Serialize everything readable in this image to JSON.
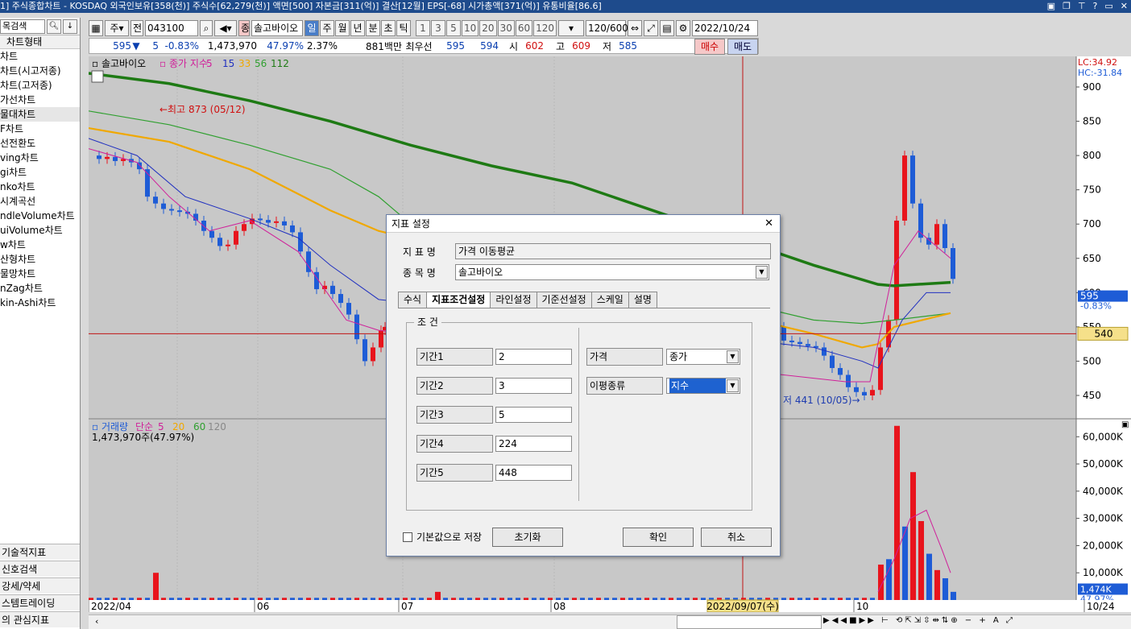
{
  "window": {
    "title": "1] 주식종합차트 - KOSDAQ 외국인보유[358(천)] 주식수[62,279(천)] 액면[500] 자본금[311(억)] 결산[12월] EPS[-68] 시가총액[371(억)] 유통비율[86.6]"
  },
  "left_panel": {
    "search_label": "목검색",
    "group_title": "차트형태",
    "items": [
      "차트",
      "차트(시고저종)",
      "차트(고저종)",
      "가선차트",
      "물대차트",
      "F차트",
      "선전환도",
      "ving차트",
      "gi차트",
      "nko차트",
      "시계곡선",
      "ndleVolume차트",
      "uiVolume차트",
      "w차트",
      "산형차트",
      "물망차트",
      "nZag차트",
      "kin-Ashi차트"
    ],
    "bottom": [
      "기술적지표",
      "신호검색",
      "강세/약세",
      "스템트레이딩",
      "의 관심지표"
    ]
  },
  "toolbar": {
    "code": "043100",
    "name": "솔고바이오",
    "periods": [
      "일",
      "주",
      "월",
      "년",
      "분",
      "초",
      "틱"
    ],
    "intervals": [
      "1",
      "3",
      "5",
      "10",
      "20",
      "30",
      "60",
      "120"
    ],
    "count": "120/600",
    "date": "2022/10/24",
    "jeon": "전",
    "ju": "주",
    "jong": "종"
  },
  "quote": {
    "price": "595",
    "change_arrow": "▼",
    "change": "5",
    "change_pct": "-0.83%",
    "volume": "1,473,970",
    "vol_ratio": "47.97%",
    "turnover": "2.37%",
    "amount": "881백만",
    "best_label": "최우선",
    "ask": "595",
    "bid": "594",
    "open_label": "시",
    "open": "602",
    "high_label": "고",
    "high": "609",
    "low_label": "저",
    "low": "585",
    "buy": "매수",
    "sell": "매도"
  },
  "chart": {
    "price_legend": {
      "name": "솔고바이오",
      "ma_title": "종가 지수",
      "periods": [
        "5",
        "15",
        "33",
        "56",
        "112"
      ]
    },
    "high_note": "최고 873 (05/12)",
    "low_note": "저 441 (10/05)",
    "lc": "LC:34.92",
    "hc": "HC:-31.84",
    "price_ticks": [
      "900",
      "850",
      "800",
      "750",
      "700",
      "650",
      "600",
      "550",
      "500",
      "450"
    ],
    "cur_price": "595",
    "cur_pct": "-0.83%",
    "cross_price": "540",
    "vol_legend": {
      "name": "거래량",
      "ma_title": "단순",
      "periods": [
        "5",
        "20",
        "60",
        "120"
      ]
    },
    "vol_value": "1,473,970주(47.97%)",
    "vol_ticks": [
      "60,000K",
      "50,000K",
      "40,000K",
      "30,000K",
      "20,000K",
      "10,000K"
    ],
    "vol_cur": "1,474K",
    "vol_pct": "47.97%",
    "x_labels": [
      "2022/04",
      "06",
      "07",
      "08",
      "10",
      "10/24"
    ],
    "cross_date": "2022/09/07(수)"
  },
  "colors": {
    "up": "#e8141c",
    "down": "#1e5cd6",
    "ma5": "#d0209a",
    "ma15": "#2030c0",
    "ma33": "#f0a800",
    "ma56": "#30a030",
    "ma112": "#1e7a14",
    "crosshair": "#c01414"
  },
  "dialog": {
    "title": "지표 설정",
    "name_label": "지 표 명",
    "name_value": "가격 이동평균",
    "stock_label": "종 목 명",
    "stock_value": "솔고바이오",
    "tabs": [
      "수식",
      "지표조건설정",
      "라인설정",
      "기준선설정",
      "스케일",
      "설명"
    ],
    "group": "조 건",
    "periods": [
      {
        "label": "기간1",
        "value": "2"
      },
      {
        "label": "기간2",
        "value": "3"
      },
      {
        "label": "기간3",
        "value": "5"
      },
      {
        "label": "기간4",
        "value": "224"
      },
      {
        "label": "기간5",
        "value": "448"
      }
    ],
    "price_label": "가격",
    "price_value": "종가",
    "ma_type_label": "이평종류",
    "ma_type_value": "지수",
    "save_default": "기본값으로 저장",
    "reset": "초기화",
    "ok": "확인",
    "cancel": "취소"
  }
}
